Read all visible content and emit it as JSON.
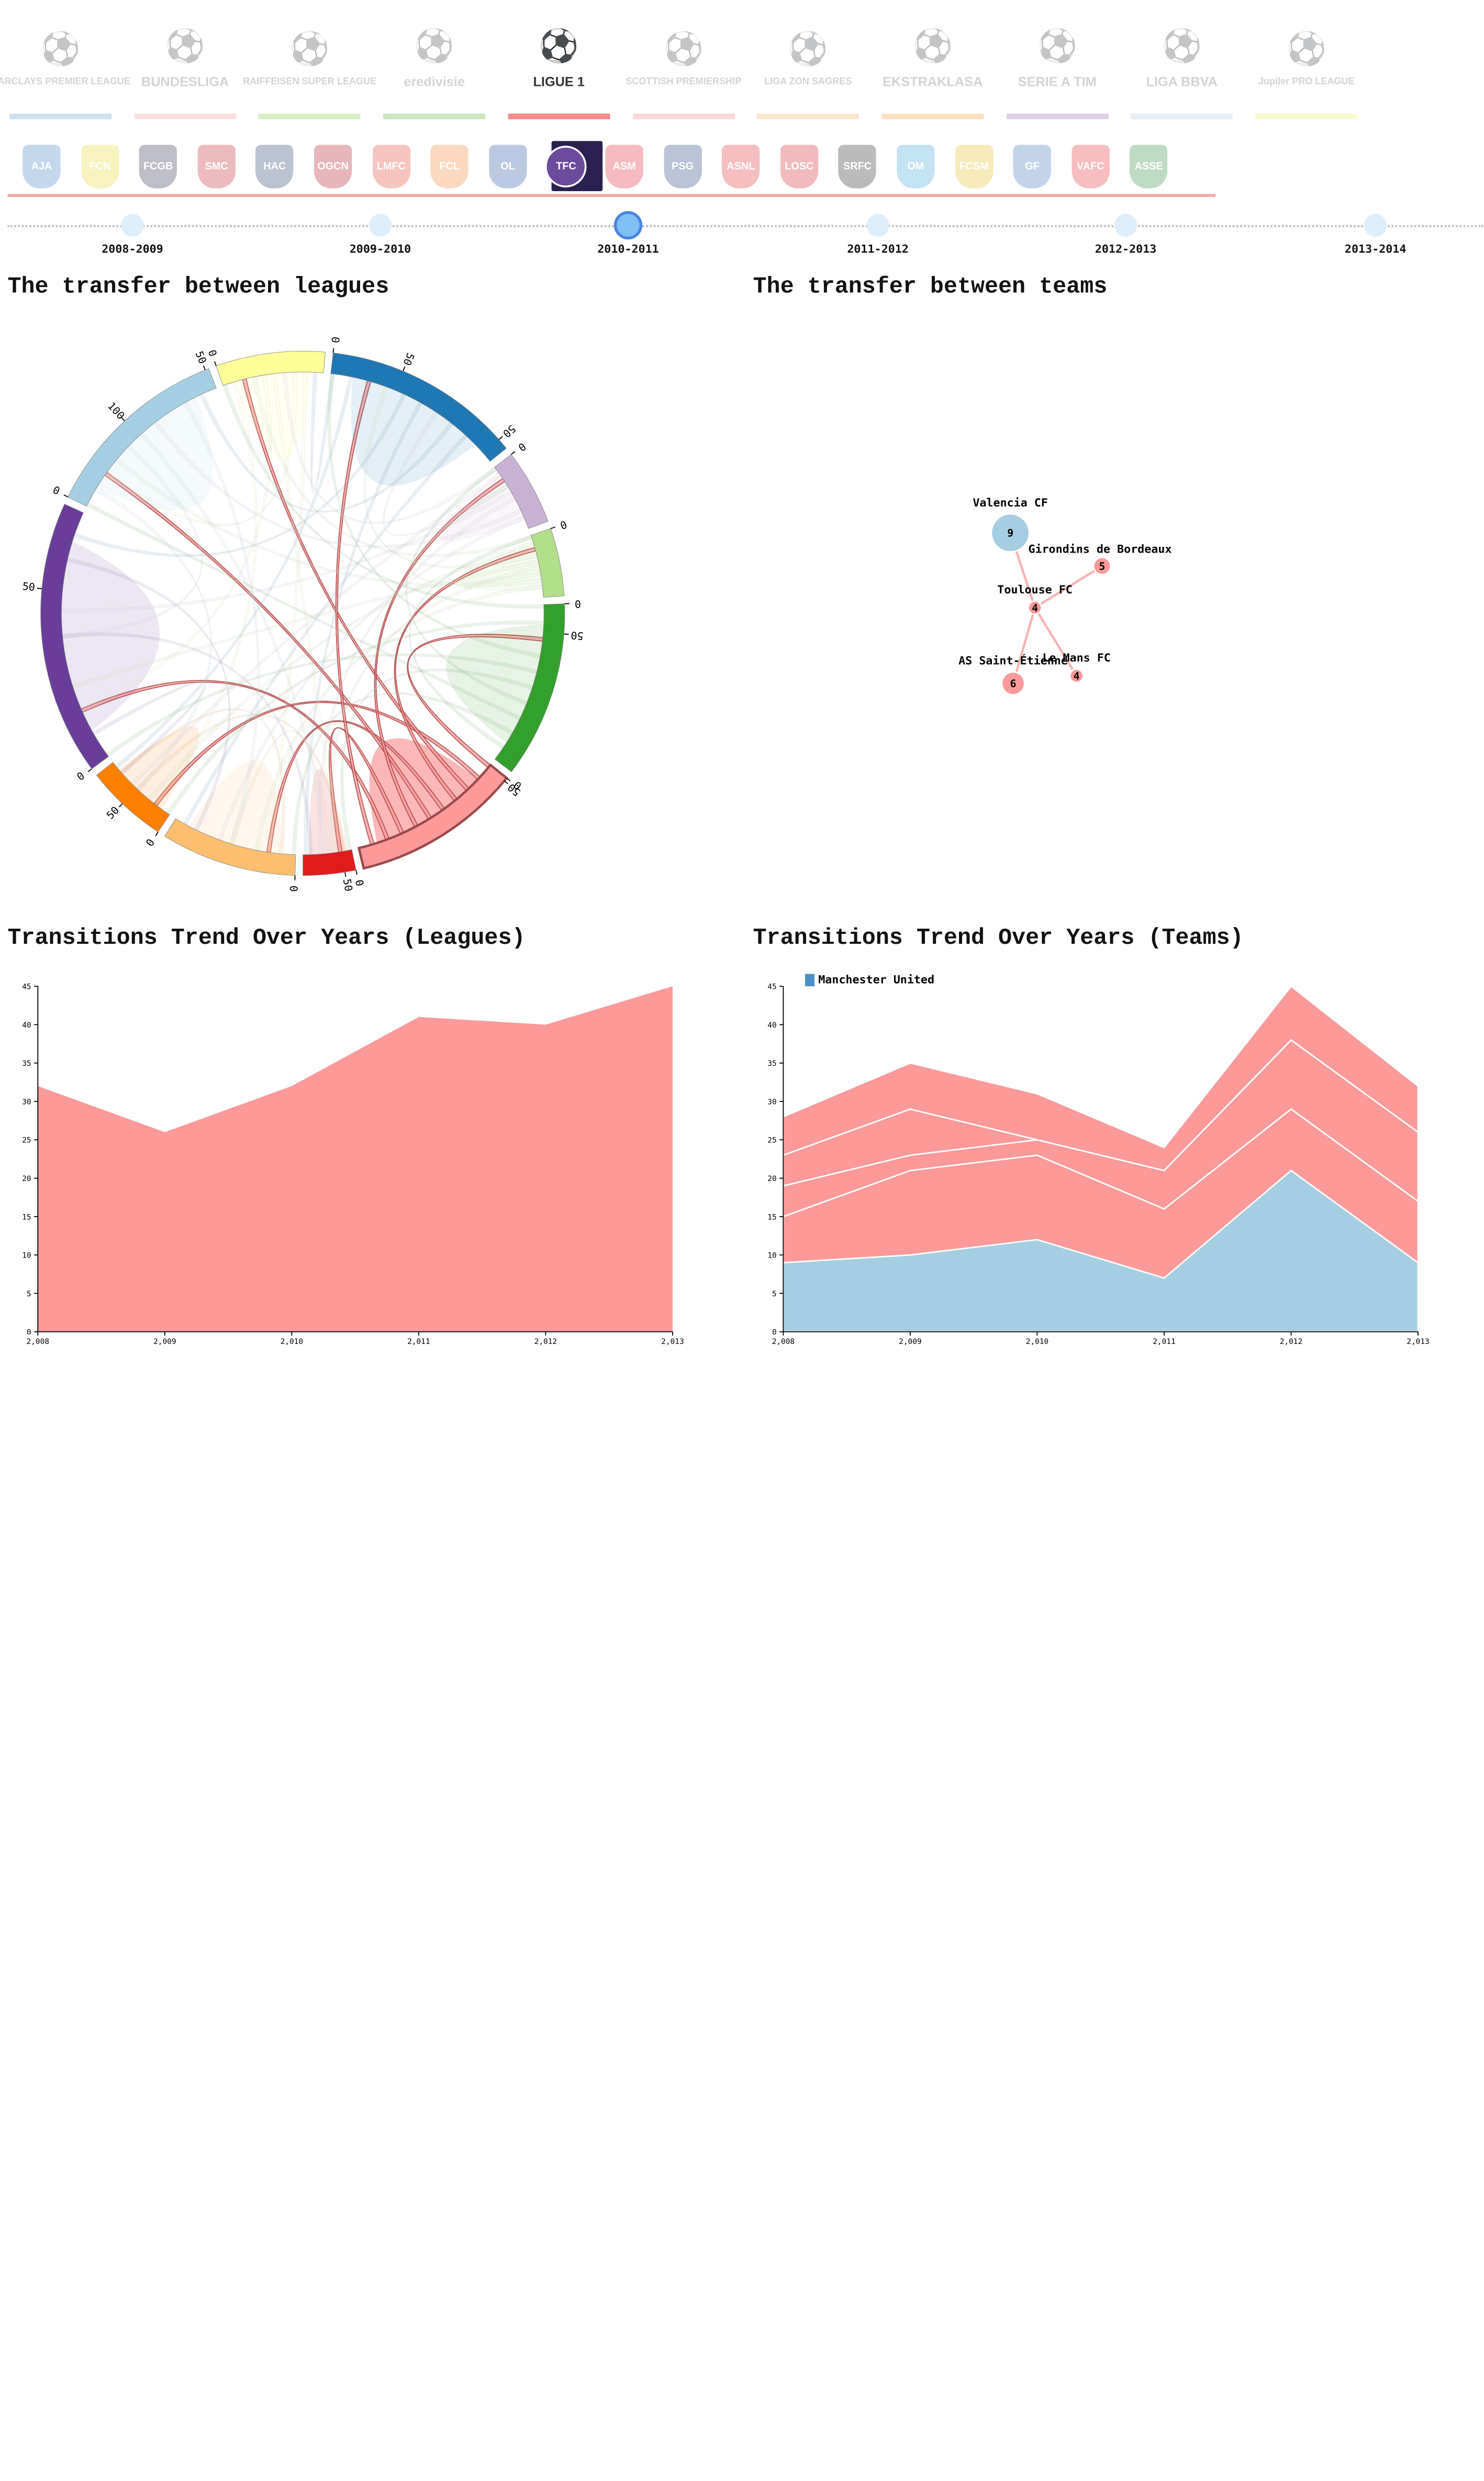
{
  "leagues": [
    {
      "name": "BARCLAYS PREMIER LEAGUE",
      "icon": "lion-crest-icon",
      "color": "#a6c8e6",
      "active": false
    },
    {
      "name": "BUNDESLIGA",
      "icon": "bundesliga-player-icon",
      "color": "#f7c6c6",
      "active": false
    },
    {
      "name": "RAIFFEISEN SUPER LEAGUE",
      "icon": "super-league-player-icon",
      "color": "#b8e39a",
      "active": false
    },
    {
      "name": "eredivisie",
      "icon": "eredivisie-ball-icon",
      "color": "#9ed48a",
      "active": false
    },
    {
      "name": "LIGUE 1",
      "icon": "ligue1-ball-icon",
      "color": "#f78b8b",
      "active": true
    },
    {
      "name": "SCOTTISH PREMIERSHIP",
      "icon": "scottish-lion-icon",
      "color": "#f7b6b6",
      "active": false
    },
    {
      "name": "LIGA ZON SAGRES",
      "icon": "portugal-shield-icon",
      "color": "#f8d3a0",
      "active": false
    },
    {
      "name": "EKSTRAKLASA",
      "icon": "ekstraklasa-ball-icon",
      "color": "#fbc987",
      "active": false
    },
    {
      "name": "SERIE A TIM",
      "icon": "serie-a-shield-icon",
      "color": "#c4a9d8",
      "active": false
    },
    {
      "name": "LIGA BBVA",
      "icon": "liga-bbva-ball-icon",
      "color": "#d4e4f2",
      "active": false
    },
    {
      "name": "Jupiler PRO LEAGUE",
      "icon": "jupiler-lion-icon",
      "color": "#f7f6a8",
      "active": false
    }
  ],
  "teams": [
    {
      "abbr": "AJA",
      "icon": "auxerre-crest-icon",
      "color": "#3b7fc4",
      "active": false
    },
    {
      "abbr": "FCN",
      "icon": "nantes-crest-icon",
      "color": "#e7d630",
      "active": false
    },
    {
      "abbr": "FCGB",
      "icon": "bordeaux-crest-icon",
      "color": "#2a2a4a",
      "active": false
    },
    {
      "abbr": "SMC",
      "icon": "caen-crest-icon",
      "color": "#c0202a",
      "active": false
    },
    {
      "abbr": "HAC",
      "icon": "le-havre-crest-icon",
      "color": "#1e3a6b",
      "active": false
    },
    {
      "abbr": "OGCN",
      "icon": "nice-crest-icon",
      "color": "#b01020",
      "active": false
    },
    {
      "abbr": "LMFC",
      "icon": "le-mans-crest-icon",
      "color": "#e0402a",
      "active": false
    },
    {
      "abbr": "FCL",
      "icon": "lorient-crest-icon",
      "color": "#f08030",
      "active": false
    },
    {
      "abbr": "OL",
      "icon": "lyon-crest-icon",
      "color": "#2050a0",
      "active": false
    },
    {
      "abbr": "TFC",
      "icon": "toulouse-crest-icon",
      "color": "#6d4a9c",
      "active": true
    },
    {
      "abbr": "ASM",
      "icon": "monaco-crest-icon",
      "color": "#e02030",
      "active": false
    },
    {
      "abbr": "PSG",
      "icon": "psg-crest-icon",
      "color": "#1b3b7a",
      "active": false
    },
    {
      "abbr": "ASNL",
      "icon": "nancy-crest-icon",
      "color": "#e02a2a",
      "active": false
    },
    {
      "abbr": "LOSC",
      "icon": "lille-crest-icon",
      "color": "#d0202a",
      "active": false
    },
    {
      "abbr": "SRFC",
      "icon": "rennes-crest-icon",
      "color": "#202020",
      "active": false
    },
    {
      "abbr": "OM",
      "icon": "marseille-crest-icon",
      "color": "#3ba0d8",
      "active": false
    },
    {
      "abbr": "FCSM",
      "icon": "sochaux-crest-icon",
      "color": "#e7b820",
      "active": false
    },
    {
      "abbr": "GF",
      "icon": "grenoble-crest-icon",
      "color": "#3a70b8",
      "active": false
    },
    {
      "abbr": "VAFC",
      "icon": "valenciennes-crest-icon",
      "color": "#e02a2a",
      "active": false
    },
    {
      "abbr": "ASSE",
      "icon": "saint-etienne-crest-icon",
      "color": "#2a8a3a",
      "active": false
    }
  ],
  "seasons": [
    {
      "label": "2008-2009",
      "active": false
    },
    {
      "label": "2009-2010",
      "active": false
    },
    {
      "label": "2010-2011",
      "active": true
    },
    {
      "label": "2011-2012",
      "active": false
    },
    {
      "label": "2012-2013",
      "active": false
    },
    {
      "label": "2013-2014",
      "active": false
    }
  ],
  "titles": {
    "chord": "The transfer between leagues",
    "network": "The transfer between teams",
    "leagues_trend": "Transitions Trend Over Years (Leagues)",
    "teams_trend": "Transitions Trend Over Years (Teams)"
  },
  "chart_data": [
    {
      "type": "chord",
      "title": "The transfer between leagues",
      "groups": [
        {
          "color": "#fb9a99",
          "value": 45,
          "ticks": [
            0,
            50
          ],
          "highlighted": true
        },
        {
          "color": "#e31a1c",
          "value": 14,
          "ticks": [
            0
          ]
        },
        {
          "color": "#fdbf6f",
          "value": 36,
          "ticks": [
            0,
            50
          ]
        },
        {
          "color": "#ff7f00",
          "value": 22,
          "ticks": [
            0
          ]
        },
        {
          "color": "#6a3d9a",
          "value": 73,
          "ticks": [
            0,
            50,
            100
          ]
        },
        {
          "color": "#a6cee3",
          "value": 51,
          "ticks": [
            0,
            50
          ]
        },
        {
          "color": "#ffff99",
          "value": 29,
          "ticks": [
            0,
            50
          ]
        },
        {
          "color": "#1f78b4",
          "value": 53,
          "ticks": [
            0,
            50
          ]
        },
        {
          "color": "#cab2d6",
          "value": 20,
          "ticks": [
            0,
            50
          ]
        },
        {
          "color": "#b2df8a",
          "value": 18,
          "ticks": [
            0
          ]
        },
        {
          "color": "#33a02c",
          "value": 47,
          "ticks": [
            0,
            50
          ]
        }
      ]
    },
    {
      "type": "network",
      "title": "The transfer between teams",
      "nodes": [
        {
          "name": "Valencia CF",
          "value": 9,
          "color": "#a6cee3"
        },
        {
          "name": "Girondins de Bordeaux",
          "value": 5,
          "color": "#fb9a99"
        },
        {
          "name": "Toulouse FC",
          "value": 4,
          "color": "#fb9a99"
        },
        {
          "name": "AS Saint-Étienne",
          "value": 6,
          "color": "#fb9a99"
        },
        {
          "name": "Le Mans FC",
          "value": 4,
          "color": "#fb9a99"
        }
      ],
      "links": [
        {
          "source": "Toulouse FC",
          "target": "Valencia CF"
        },
        {
          "source": "Toulouse FC",
          "target": "Girondins de Bordeaux"
        },
        {
          "source": "Toulouse FC",
          "target": "AS Saint-Étienne"
        },
        {
          "source": "Toulouse FC",
          "target": "Le Mans FC"
        }
      ]
    },
    {
      "type": "area",
      "title": "Transitions Trend Over Years (Leagues)",
      "x": [
        2008,
        2009,
        2010,
        2011,
        2012,
        2013
      ],
      "xticks": [
        "2,008",
        "2,009",
        "2,010",
        "2,011",
        "2,012",
        "2,013"
      ],
      "ylim": [
        0,
        45
      ],
      "yticks": [
        0,
        5,
        10,
        15,
        20,
        25,
        30,
        35,
        40,
        45
      ],
      "series": [
        {
          "color": "#fb9a99",
          "values": [
            32,
            26,
            32,
            41,
            40,
            45
          ]
        }
      ]
    },
    {
      "type": "area",
      "stacked": true,
      "title": "Transitions Trend Over Years (Teams)",
      "x": [
        2008,
        2009,
        2010,
        2011,
        2012,
        2013
      ],
      "xticks": [
        "2,008",
        "2,009",
        "2,010",
        "2,011",
        "2,012",
        "2,013"
      ],
      "ylim": [
        0,
        45
      ],
      "yticks": [
        0,
        5,
        10,
        15,
        20,
        25,
        30,
        35,
        40,
        45
      ],
      "legend": {
        "label": "Manchester United",
        "color": "#4a90c8",
        "position": "top-left"
      },
      "series": [
        {
          "color": "#a6cee3",
          "values": [
            9,
            10,
            12,
            7,
            21,
            9
          ]
        },
        {
          "color": "#fb9a99",
          "values": [
            6,
            11,
            11,
            9,
            8,
            8
          ]
        },
        {
          "color": "#fb9a99",
          "values": [
            4,
            2,
            2,
            5,
            9,
            9
          ]
        },
        {
          "color": "#fb9a99",
          "values": [
            4,
            6,
            0,
            0,
            0,
            0
          ]
        },
        {
          "color": "#fb9a99",
          "values": [
            5,
            6,
            6,
            3,
            7,
            6
          ]
        }
      ]
    }
  ]
}
